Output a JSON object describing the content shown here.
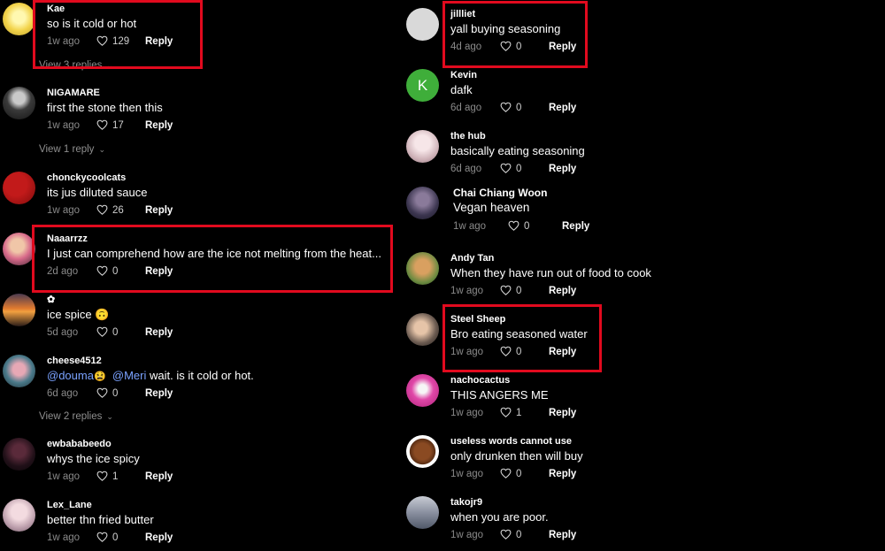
{
  "left_column": [
    {
      "user": "Kae",
      "text": "so is it cold or hot",
      "date": "1w ago",
      "likes": "129",
      "reply": "Reply"
    },
    {
      "user": "NIGAMARE",
      "text": "first the stone then this",
      "date": "1w ago",
      "likes": "17",
      "reply": "Reply"
    },
    {
      "user": "chonckycoolcats",
      "text": "its jus diluted sauce",
      "date": "1w ago",
      "likes": "26",
      "reply": "Reply"
    },
    {
      "user": "Naaarrzz",
      "text": "I just can comprehend how are the ice not melting from the heat...",
      "date": "2d ago",
      "likes": "0",
      "reply": "Reply"
    },
    {
      "user": "✿",
      "text": "ice spice 🙃",
      "date": "5d ago",
      "likes": "0",
      "reply": "Reply"
    },
    {
      "user": "cheese4512",
      "mention1": "@douma",
      "emoji": "😫",
      "mention2": "@Meri",
      "text_rest": "wait. is it cold or hot.",
      "date": "6d ago",
      "likes": "0",
      "reply": "Reply"
    },
    {
      "user": "ewbababeedo",
      "text": "whys the ice spicy",
      "date": "1w ago",
      "likes": "1",
      "reply": "Reply"
    },
    {
      "user": "Lex_Lane",
      "text": "better thn fried butter",
      "date": "1w ago",
      "likes": "0",
      "reply": "Reply"
    }
  ],
  "replies_links": [
    "View 3 replies",
    "View 1 reply",
    "View 2 replies"
  ],
  "right_column": [
    {
      "user": "jillliet",
      "text": "yall buying seasoning",
      "date": "4d ago",
      "likes": "0",
      "reply": "Reply"
    },
    {
      "user": "Kevin",
      "avatar_letter": "K",
      "text": "dafk",
      "date": "6d ago",
      "likes": "0",
      "reply": "Reply"
    },
    {
      "user": "the hub",
      "text": "basically eating seasoning",
      "date": "6d ago",
      "likes": "0",
      "reply": "Reply"
    },
    {
      "user": "Chai Chiang Woon",
      "text": "Vegan heaven",
      "date": "1w ago",
      "likes": "0",
      "reply": "Reply"
    },
    {
      "user": "Andy Tan",
      "text": "When they have run out of food to cook",
      "date": "1w ago",
      "likes": "0",
      "reply": "Reply"
    },
    {
      "user": "Steel Sheep",
      "text": "Bro eating seasoned water",
      "date": "1w ago",
      "likes": "0",
      "reply": "Reply"
    },
    {
      "user": "nachocactus",
      "text": "THIS ANGERS ME",
      "date": "1w ago",
      "likes": "1",
      "reply": "Reply"
    },
    {
      "user": "useless words cannot use",
      "text": "only drunken then will buy",
      "date": "1w ago",
      "likes": "0",
      "reply": "Reply"
    },
    {
      "user": "takojr9",
      "text": "when you are poor.",
      "date": "1w ago",
      "likes": "0",
      "reply": "Reply"
    }
  ],
  "colors": {
    "background": "#000000",
    "highlight": "#e10a1e",
    "mention": "#7aa2ff",
    "kevin_avatar": "#3fae3a"
  },
  "icons": {
    "like": "heart-icon",
    "expand": "chevron-down-icon"
  }
}
